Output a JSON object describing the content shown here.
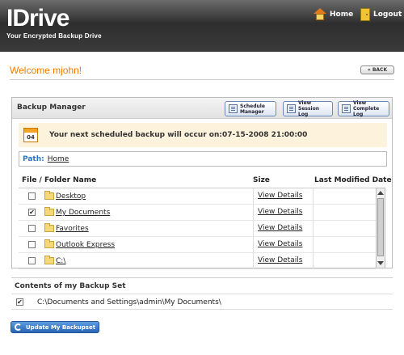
{
  "brand": {
    "name": "IDrive",
    "tagline": "Your Encrypted Backup Drive"
  },
  "nav": {
    "home": "Home",
    "logout": "Logout"
  },
  "welcome": "Welcome mjohn!",
  "back_label": "« BACK",
  "backup_manager": {
    "title": "Backup Manager",
    "buttons": [
      {
        "line1": "Schedule",
        "line2": "Manager",
        "icon": "clock-calendar-icon"
      },
      {
        "line1": "View",
        "line2": "Session Log",
        "icon": "log-icon"
      },
      {
        "line1": "View",
        "line2": "Complete Log",
        "icon": "log-icon"
      }
    ],
    "calendar_day": "04",
    "schedule_notice": "Your next scheduled backup will occur on:07-15-2008 21:00:00",
    "path_label": "Path:",
    "path_value": "Home",
    "columns": {
      "name": "File / Folder Name",
      "size": "Size",
      "modified": "Last Modified Date"
    },
    "rows": [
      {
        "name": "Desktop",
        "size": "View Details",
        "checked": ""
      },
      {
        "name": "My Documents",
        "size": "View Details",
        "checked": "✔"
      },
      {
        "name": "Favorites",
        "size": "View Details",
        "checked": ""
      },
      {
        "name": "Outlook Express",
        "size": "View Details",
        "checked": ""
      },
      {
        "name": "C:\\",
        "size": "View Details",
        "checked": ""
      }
    ]
  },
  "backup_set": {
    "title": "Contents of my Backup Set",
    "items": [
      {
        "path": "C:\\Documents and Settings\\admin\\My Documents\\",
        "checked": "✔"
      }
    ]
  },
  "update_button": "Update My Backupset",
  "colors": {
    "header": "#3a3a3a",
    "accent_orange": "#f07c00",
    "link_blue": "#2a73c4",
    "button_blue": "#2866b4"
  }
}
